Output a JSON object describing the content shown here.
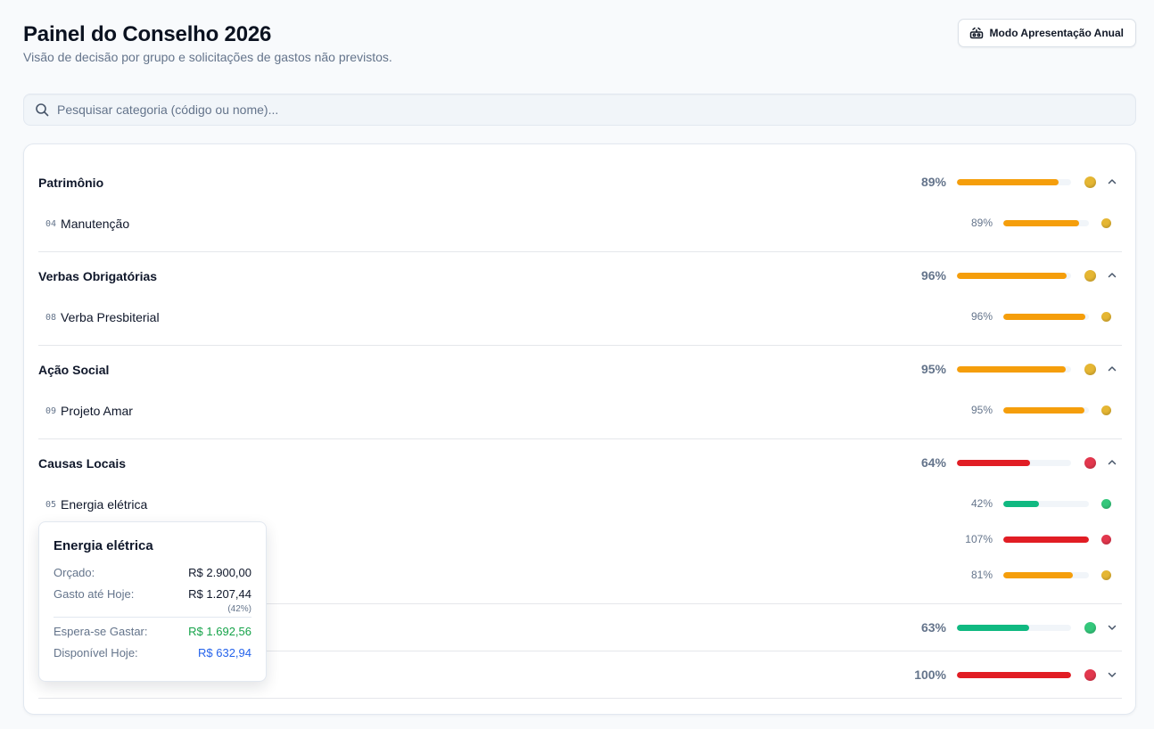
{
  "header": {
    "title": "Painel do Conselho 2026",
    "subtitle": "Visão de decisão por grupo e solicitações de gastos não previstos.",
    "present_button": "Modo Apresentação Anual"
  },
  "search": {
    "placeholder": "Pesquisar categoria (código ou nome)..."
  },
  "colors": {
    "orange": "#f59e0b",
    "red": "#e11d24",
    "green": "#10b981",
    "dot_yellow": "#e5b633",
    "dot_red": "#e2374d",
    "dot_green": "#34c77b",
    "track": "#f1f5f9"
  },
  "groups": [
    {
      "name": "Patrimônio",
      "pct_label": "89%",
      "value": 0.89,
      "status": "orange",
      "expanded": true,
      "items": [
        {
          "code": "04",
          "name": "Manutenção",
          "pct_label": "89%",
          "value": 0.89,
          "status": "orange"
        }
      ]
    },
    {
      "name": "Verbas Obrigatórias",
      "pct_label": "96%",
      "value": 0.96,
      "status": "orange",
      "expanded": true,
      "items": [
        {
          "code": "08",
          "name": "Verba Presbiterial",
          "pct_label": "96%",
          "value": 0.96,
          "status": "orange"
        }
      ]
    },
    {
      "name": "Ação Social",
      "pct_label": "95%",
      "value": 0.95,
      "status": "orange",
      "expanded": true,
      "items": [
        {
          "code": "09",
          "name": "Projeto Amar",
          "pct_label": "95%",
          "value": 0.95,
          "status": "orange"
        }
      ]
    },
    {
      "name": "Causas Locais",
      "pct_label": "64%",
      "value": 0.64,
      "status": "red",
      "expanded": true,
      "items": [
        {
          "code": "05",
          "name": "Energia elétrica",
          "pct_label": "42%",
          "value": 0.42,
          "status": "green"
        },
        {
          "pct_label": "107%",
          "value": 1.0,
          "status": "red"
        },
        {
          "pct_label": "81%",
          "value": 0.81,
          "status": "orange"
        }
      ]
    },
    {
      "pct_label": "63%",
      "value": 0.63,
      "status": "green",
      "expanded": false
    },
    {
      "pct_label": "100%",
      "value": 1.0,
      "status": "red",
      "expanded": false
    }
  ],
  "tooltip": {
    "title": "Energia elétrica",
    "budget_label": "Orçado:",
    "budget_value": "R$ 2.900,00",
    "spent_label": "Gasto até Hoje:",
    "spent_value": "R$ 1.207,44",
    "spent_pct": "(42%)",
    "expected_label": "Espera-se Gastar:",
    "expected_value": "R$ 1.692,56",
    "expected_color": "#16a34a",
    "available_label": "Disponível Hoje:",
    "available_value": "R$ 632,94",
    "available_color": "#2563eb"
  }
}
